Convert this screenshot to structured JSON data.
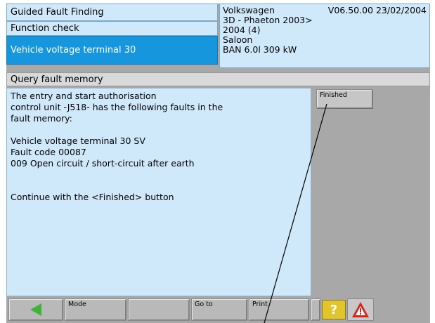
{
  "header": {
    "title": "Guided Fault Finding",
    "subtitle": "Function check",
    "active_item": "Vehicle voltage terminal 30"
  },
  "vehicle": {
    "make": "Volkswagen",
    "version": "V06.50.00 23/02/2004",
    "model": "3D - Phaeton 2003>",
    "year": "2004 (4)",
    "body": "Saloon",
    "engine": "BAN 6.0l 309 kW"
  },
  "section": {
    "title": "Query fault memory"
  },
  "message": {
    "intro": "The entry and start authorisation\ncontrol unit -J518- has the following faults in the\nfault memory:",
    "fault_name": "Vehicle voltage terminal 30 SV",
    "fault_code": "Fault code 00087",
    "fault_desc": "009 Open circuit / short-circuit after earth",
    "instruction": "Continue with the <Finished> button"
  },
  "buttons": {
    "finished": "Finished"
  },
  "bottom_bar": {
    "mode": "Mode",
    "goto": "Go to",
    "print": "Print",
    "help_symbol": "?",
    "icons": [
      "back-arrow-icon",
      "help-icon",
      "warning-icon"
    ]
  },
  "colors": {
    "panel": "#cfe9fb",
    "active": "#1596dd",
    "frame": "#a8a8a8",
    "back_arrow": "#3fb23a",
    "help": "#e2c52d",
    "warning": "#d02a1e"
  }
}
